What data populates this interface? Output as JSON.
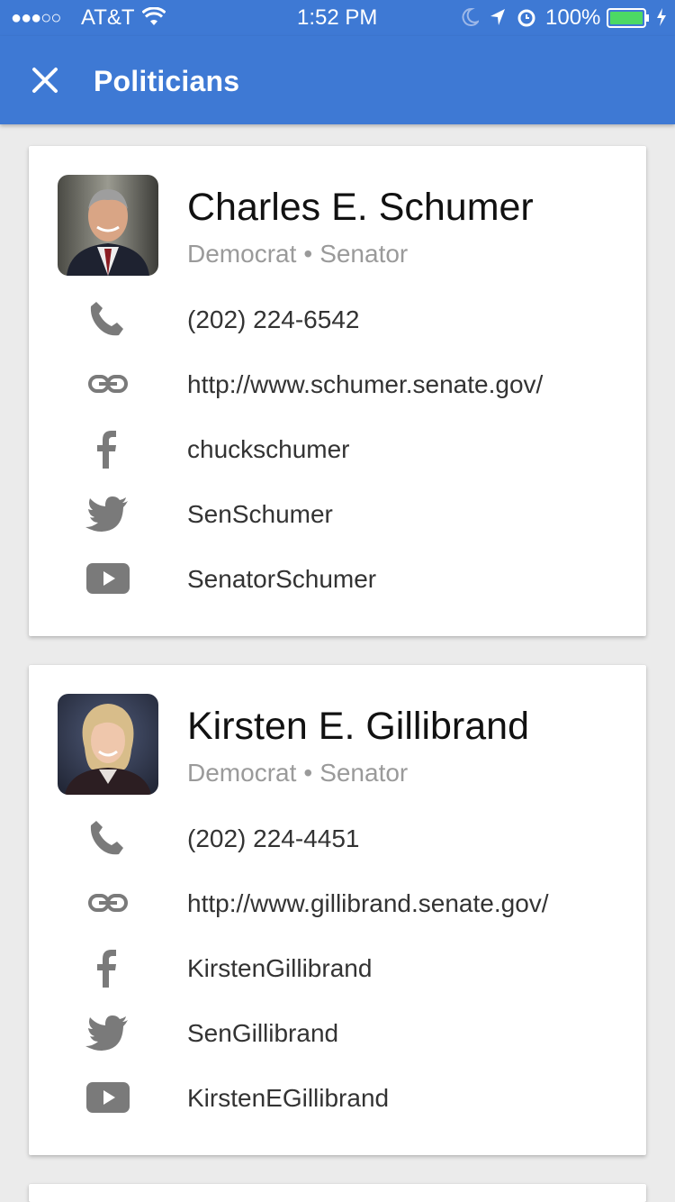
{
  "status_bar": {
    "carrier": "AT&T",
    "time": "1:52 PM",
    "battery": "100%"
  },
  "app_bar": {
    "title": "Politicians",
    "close_icon": "close-icon"
  },
  "colors": {
    "app_bar": "#3e79d4",
    "background": "#ebebeb",
    "icon": "#7a7a7a",
    "battery": "#4cd964"
  },
  "politicians": [
    {
      "name": "Charles E. Schumer",
      "party": "Democrat",
      "office": "Senator",
      "phone": "(202) 224-6542",
      "website": "http://www.schumer.senate.gov/",
      "facebook": "chuckschumer",
      "twitter": "SenSchumer",
      "youtube": "SenatorSchumer"
    },
    {
      "name": "Kirsten E. Gillibrand",
      "party": "Democrat",
      "office": "Senator",
      "phone": "(202) 224-4451",
      "website": "http://www.gillibrand.senate.gov/",
      "facebook": "KirstenGillibrand",
      "twitter": "SenGillibrand",
      "youtube": "KirstenEGillibrand"
    }
  ],
  "icons": [
    "phone-icon",
    "link-icon",
    "facebook-icon",
    "twitter-icon",
    "youtube-icon"
  ]
}
